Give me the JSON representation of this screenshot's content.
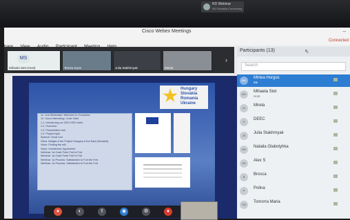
{
  "notification": {
    "title": "RD Webinar",
    "subtitle": "RD Slovakia Connecting"
  },
  "window": {
    "title": "Cisco Webex Meetings",
    "minimize": "–"
  },
  "menu": [
    "View",
    "Audio",
    "Participant",
    "Meeting",
    "Help"
  ],
  "menu_partial": "hare",
  "connection": "Connected",
  "thumbnails": [
    {
      "label": "Mihaela Stet (Host)",
      "initials": "MS"
    },
    {
      "label": "Tereza Kyne"
    },
    {
      "label": "Julia Stakhmyak"
    },
    {
      "label": "Mirela"
    }
  ],
  "next_icon": "›",
  "slide": {
    "logo_lines": [
      "Hungary",
      "Slovakia",
      "Romania",
      "Ukraine"
    ],
    "agenda": [
      "11. Live Moderator: Welcome to Ourselves",
      "12. Good Interesting: Code Glide",
      "1.1. Introducing our 2021 KSD Index",
      "1.2. Overview",
      "1.3. Presentation role",
      "1.4. Project topic",
      "Speech: Good Live",
      "Voice: Budget & the Project Hungary & the East (Slovakia)",
      "Voice: Finding the will",
      "Voice: Investment, Agreement",
      "Webinar: 1a Code Forte Fort to Fort",
      "Webinar: 1a Code Forte Fort to Fort",
      "Webinar: 1a Process: Satisfaction to Fort the Fort",
      "Webinar: 1a Process: Satisfaction to Fort the Fort"
    ]
  },
  "controls": [
    "●",
    "◐",
    "⇧",
    "◉",
    "⚙",
    "●"
  ],
  "participants": {
    "header": "Participants (13)",
    "search_placeholder": "Search",
    "list": [
      {
        "name": "Mirtea Horgos",
        "role": "Me",
        "initials": "MH",
        "selected": true
      },
      {
        "name": "Mihaela Stet",
        "role": "Host",
        "initials": "MS"
      },
      {
        "name": "Mirela",
        "role": "",
        "initials": "M"
      },
      {
        "name": "DEEC",
        "role": "",
        "initials": "D"
      },
      {
        "name": "Julia Stakhmyak",
        "role": "",
        "initials": "JS"
      },
      {
        "name": "Natalia Glabotyhka",
        "role": "",
        "initials": "NG"
      },
      {
        "name": "Alex S",
        "role": "",
        "initials": "AS"
      },
      {
        "name": "Brosca",
        "role": "",
        "initials": "B"
      },
      {
        "name": "Polina",
        "role": "",
        "initials": "P"
      },
      {
        "name": "Tomorra Maria",
        "role": "",
        "initials": "TM"
      }
    ]
  },
  "colors": {
    "accent": "#2d7dd2",
    "slide_bg": "#1b2a6b",
    "logo_star": "#f3c221"
  }
}
